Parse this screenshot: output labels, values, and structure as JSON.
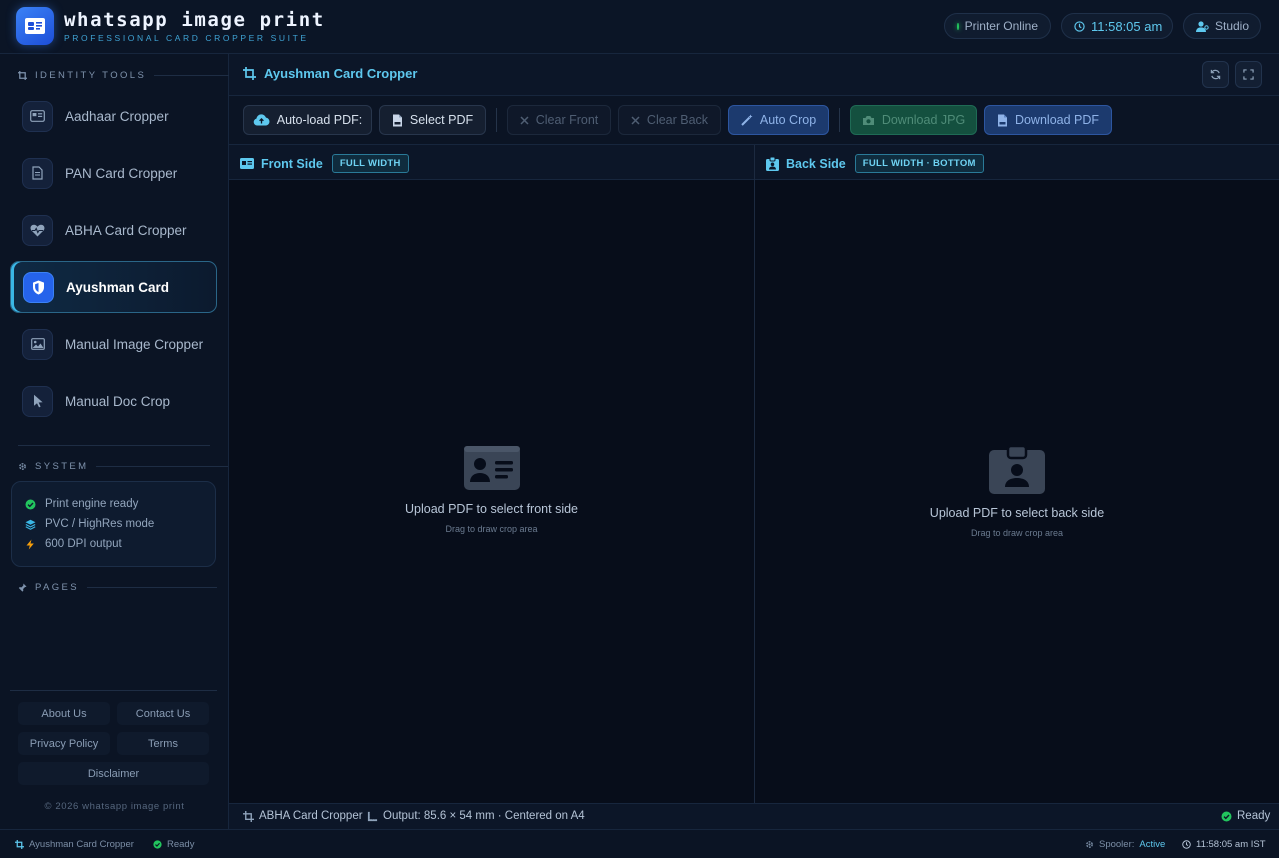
{
  "brand": {
    "title": "whatsapp image print",
    "subtitle": "PROFESSIONAL CARD CROPPER SUITE"
  },
  "header": {
    "printer_status": "Printer Online",
    "clock": "11:58:05 am",
    "studio_label": "Studio"
  },
  "sidebar": {
    "identity_heading": "IDENTITY TOOLS",
    "items": [
      {
        "label": "Aadhaar Cropper",
        "icon": "id-card-icon",
        "active": false
      },
      {
        "label": "PAN Card Cropper",
        "icon": "document-icon",
        "active": false
      },
      {
        "label": "ABHA Card Cropper",
        "icon": "heart-pulse-icon",
        "active": false
      },
      {
        "label": "Ayushman Card",
        "icon": "shield-icon",
        "active": true
      },
      {
        "label": "Manual Image Cropper",
        "icon": "image-icon",
        "active": false
      },
      {
        "label": "Manual Doc Crop",
        "icon": "pointer-icon",
        "active": false
      }
    ],
    "system_heading": "SYSTEM",
    "system_rows": [
      {
        "label": "Print engine ready",
        "icon": "check-circle-icon",
        "color": "#22c55e"
      },
      {
        "label": "PVC / HighRes mode",
        "icon": "layers-icon",
        "color": "#3ab7e6"
      },
      {
        "label": "600 DPI output",
        "icon": "bolt-icon",
        "color": "#f59e0b"
      }
    ],
    "pages_heading": "PAGES",
    "footer_links": {
      "about": "About Us",
      "contact": "Contact Us",
      "privacy": "Privacy Policy",
      "terms": "Terms",
      "disclaimer": "Disclaimer"
    },
    "copyright": "© 2026 whatsapp image print"
  },
  "main": {
    "title": "Ayushman Card Cropper",
    "toolbar": {
      "autoload": "Auto-load PDF:",
      "select_pdf": "Select PDF",
      "clear_front": "Clear Front",
      "clear_back": "Clear Back",
      "auto_crop": "Auto Crop",
      "download_jpg": "Download JPG",
      "download_pdf": "Download PDF"
    },
    "front": {
      "title": "Front Side",
      "tag": "FULL WIDTH",
      "placeholder": "Upload PDF to select front side",
      "hint": "Drag to draw crop area"
    },
    "back": {
      "title": "Back Side",
      "tag": "FULL WIDTH · BOTTOM",
      "placeholder": "Upload PDF to select back side",
      "hint": "Drag to draw crop area"
    },
    "status": {
      "tool": "ABHA Card Cropper",
      "output": "Output: 85.6 × 54 mm · Centered on A4",
      "ready": "Ready"
    }
  },
  "statusbar": {
    "tool": "Ayushman Card Cropper",
    "ready": "Ready",
    "spooler_label": "Spooler:",
    "spooler_value": "Active",
    "time": "11:58:05 am IST"
  },
  "colors": {
    "accent": "#5ec8ee",
    "brand_blue": "#2563eb",
    "ok_green": "#22c55e"
  }
}
